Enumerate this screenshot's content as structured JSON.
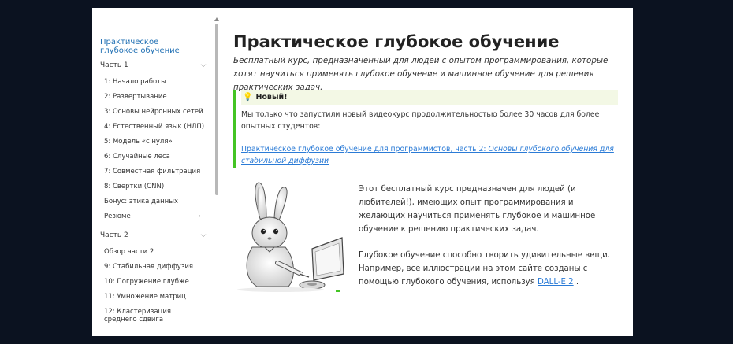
{
  "sidebar": {
    "title": "Практическое глубокое обучение",
    "part1": {
      "label": "Часть 1",
      "items": [
        "1: Начало работы",
        "2: Развертывание",
        "3: Основы нейронных сетей",
        "4: Естественный язык (НЛП)",
        "5: Модель «с нуля»",
        "6: Случайные леса",
        "7: Совместная фильтрация",
        "8: Свертки (CNN)",
        "Бонус: этика данных",
        "Резюме"
      ]
    },
    "part2": {
      "label": "Часть 2",
      "items": [
        "Обзор части 2",
        "9: Стабильная диффузия",
        "10: Погружение глубже",
        "11: Умножение матриц",
        "12: Кластеризация среднего сдвига"
      ]
    }
  },
  "main": {
    "title": "Практическое глубокое обучение",
    "lead": "Бесплатный курс, предназначенный для людей с опытом программирования, которые хотят научиться применять глубокое обучение и машинное обучение для решения практических задач.",
    "callout": {
      "label": "Новый!",
      "text": "Мы только что запустили новый видеокурс продолжительностью более 30 часов для более опытных студентов:",
      "link_main": "Практическое глубокое обучение для программистов, часть 2: ",
      "link_italic": "Основы глубокого обучения для стабильной диффузии"
    },
    "para1": "Этот бесплатный курс предназначен для людей (и любителей!), имеющих опыт программирования и желающих научиться применять глубокое и машинное обучение к решению практических задач.",
    "para2_before": "Глубокое обучение способно творить удивительные вещи. Например, все иллюстрации на этом сайте созданы с помощью глубокого обучения, используя ",
    "para2_link": "DALL-E 2",
    "para2_after": " ."
  }
}
